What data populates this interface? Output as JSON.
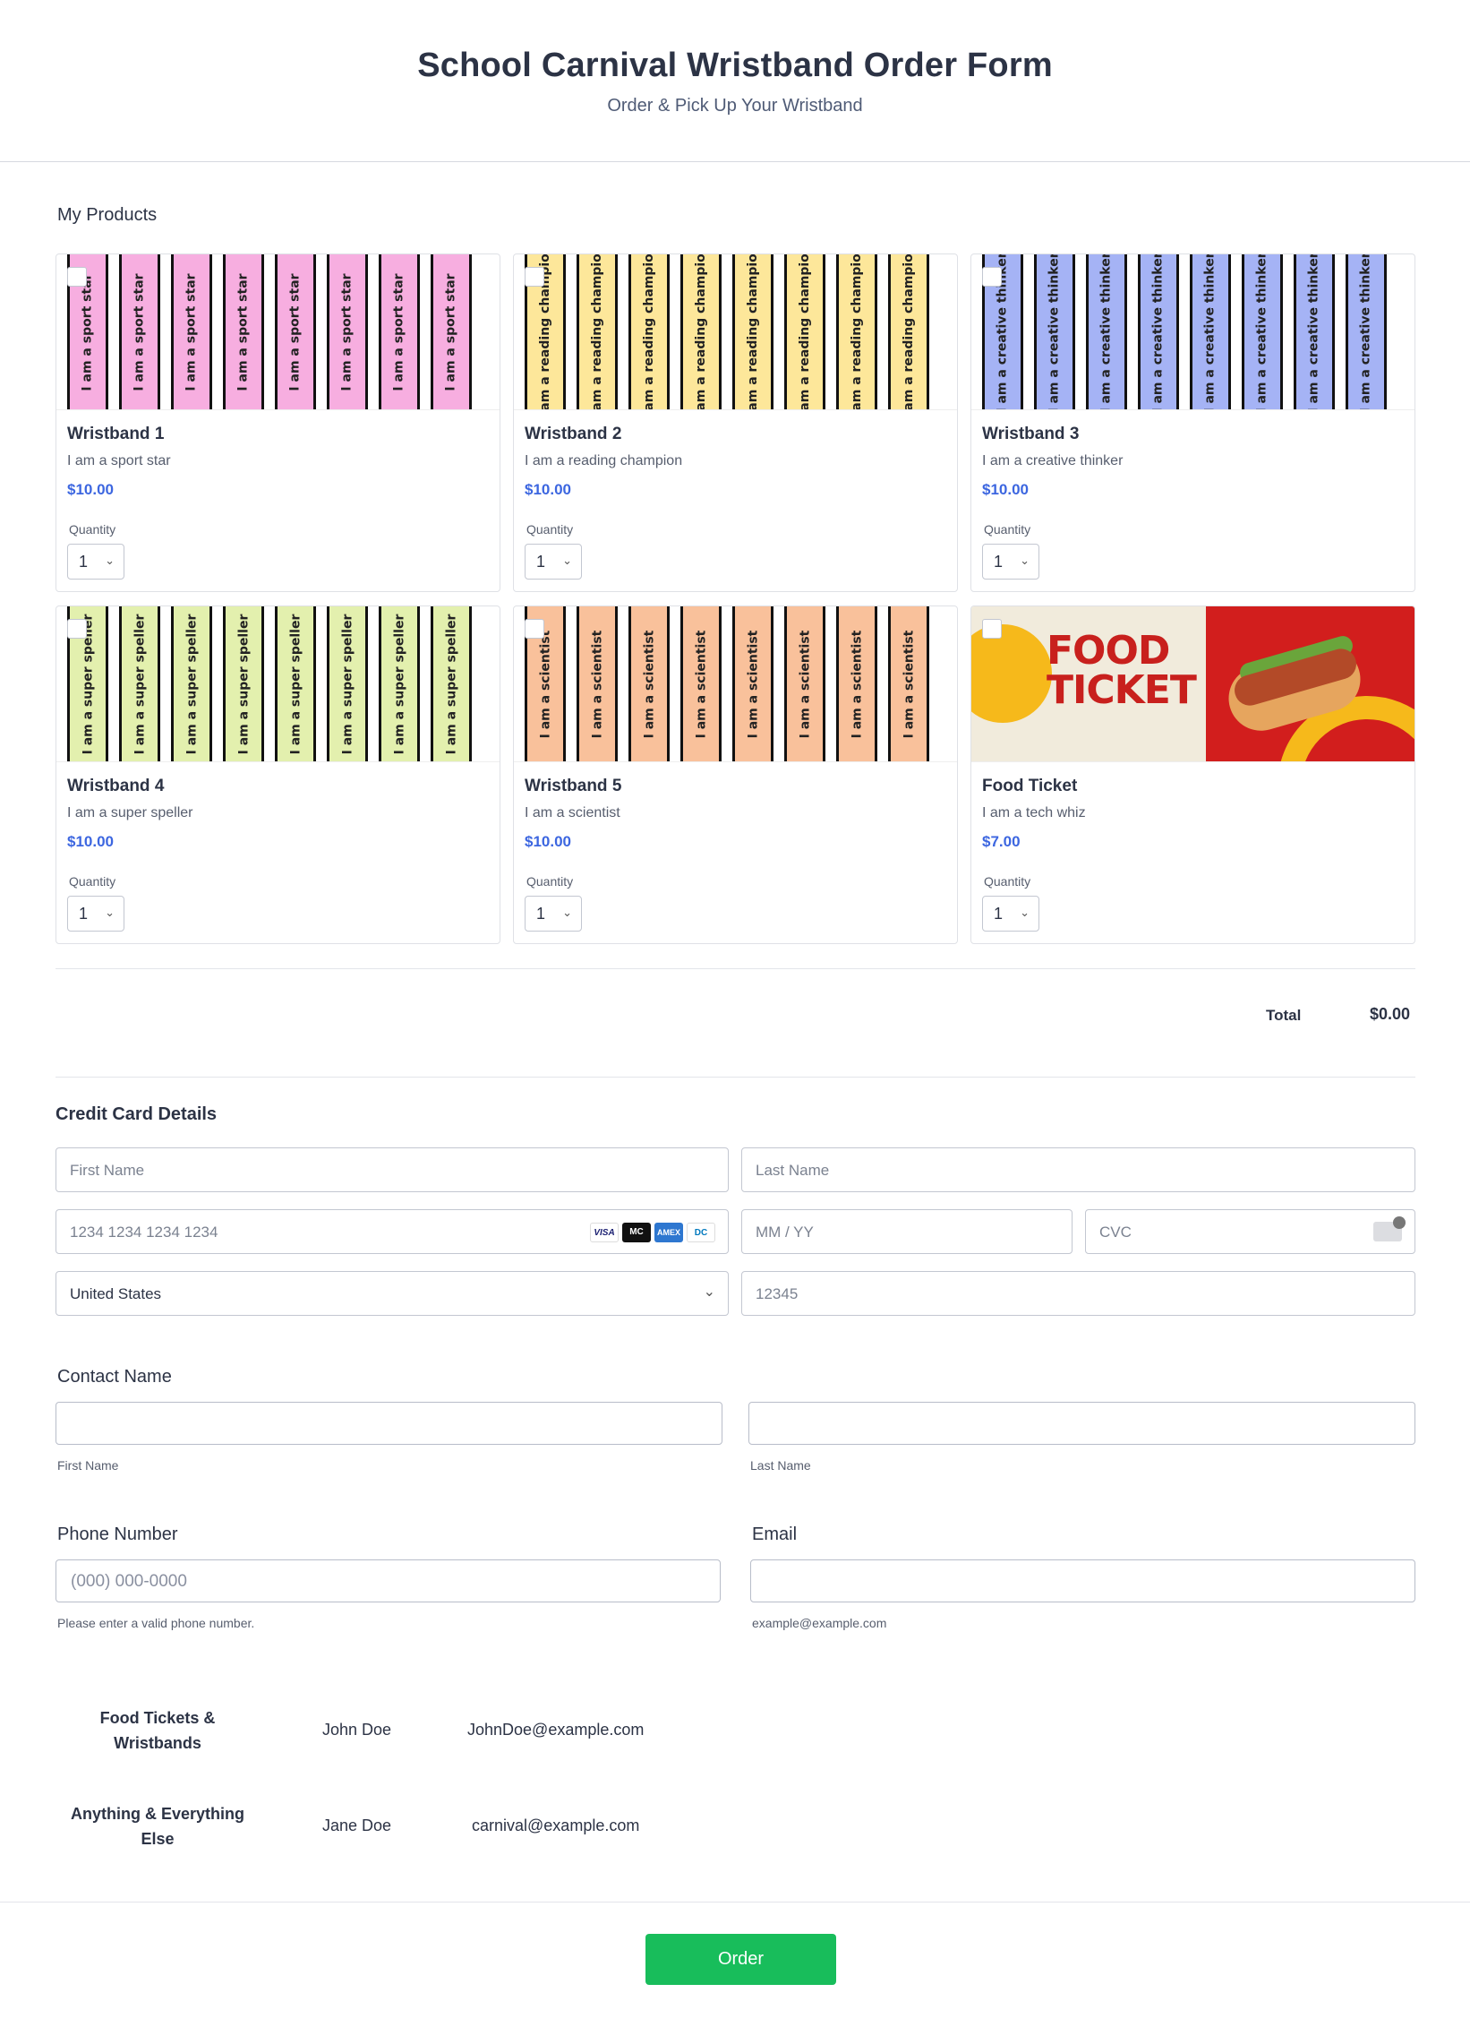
{
  "header": {
    "title": "School Carnival Wristband Order Form",
    "subtitle": "Order & Pick Up Your Wristband"
  },
  "products_label": "My Products",
  "quantity_label": "Quantity",
  "products": [
    {
      "title": "Wristband 1",
      "desc": "I am a sport star",
      "price": "$10.00",
      "qty": "1",
      "strip_text": "I am a sport star",
      "color": "#f7aee0"
    },
    {
      "title": "Wristband 2",
      "desc": "I am a reading champion",
      "price": "$10.00",
      "qty": "1",
      "strip_text": "I am a reading champion",
      "color": "#fde79a"
    },
    {
      "title": "Wristband 3",
      "desc": "I am a creative thinker",
      "price": "$10.00",
      "qty": "1",
      "strip_text": "I am a creative thinker",
      "color": "#a5b3f5"
    },
    {
      "title": "Wristband 4",
      "desc": "I am a super speller",
      "price": "$10.00",
      "qty": "1",
      "strip_text": "I am a super speller",
      "color": "#e3f0ae"
    },
    {
      "title": "Wristband 5",
      "desc": "I am a scientist",
      "price": "$10.00",
      "qty": "1",
      "strip_text": "I am a scientist",
      "color": "#f9c19b"
    },
    {
      "title": "Food Ticket",
      "desc": "I am a tech whiz",
      "price": "$7.00",
      "qty": "1",
      "banner": "FOOD TICKET"
    }
  ],
  "total": {
    "label": "Total",
    "value": "$0.00"
  },
  "credit_card": {
    "title": "Credit Card Details",
    "first_name_placeholder": "First Name",
    "last_name_placeholder": "Last Name",
    "card_number_placeholder": "1234 1234 1234 1234",
    "expiry_placeholder": "MM / YY",
    "cvc_placeholder": "CVC",
    "country": "United States",
    "zip_placeholder": "12345",
    "card_brands": [
      "VISA",
      "MC",
      "AMEX",
      "DC"
    ]
  },
  "contact_name": {
    "label": "Contact Name",
    "first_sub": "First Name",
    "last_sub": "Last Name"
  },
  "phone": {
    "label": "Phone Number",
    "placeholder": "(000) 000-0000",
    "hint": "Please enter a valid phone number."
  },
  "email": {
    "label": "Email",
    "hint": "example@example.com"
  },
  "contacts": [
    {
      "topic": "Food Tickets & Wristbands",
      "name": "John Doe",
      "email": "JohnDoe@example.com"
    },
    {
      "topic": "Anything & Everything Else",
      "name": "Jane Doe",
      "email": "carnival@example.com"
    }
  ],
  "submit_label": "Order",
  "colors": {
    "accent": "#3c66e0",
    "submit": "#18bd5b"
  }
}
